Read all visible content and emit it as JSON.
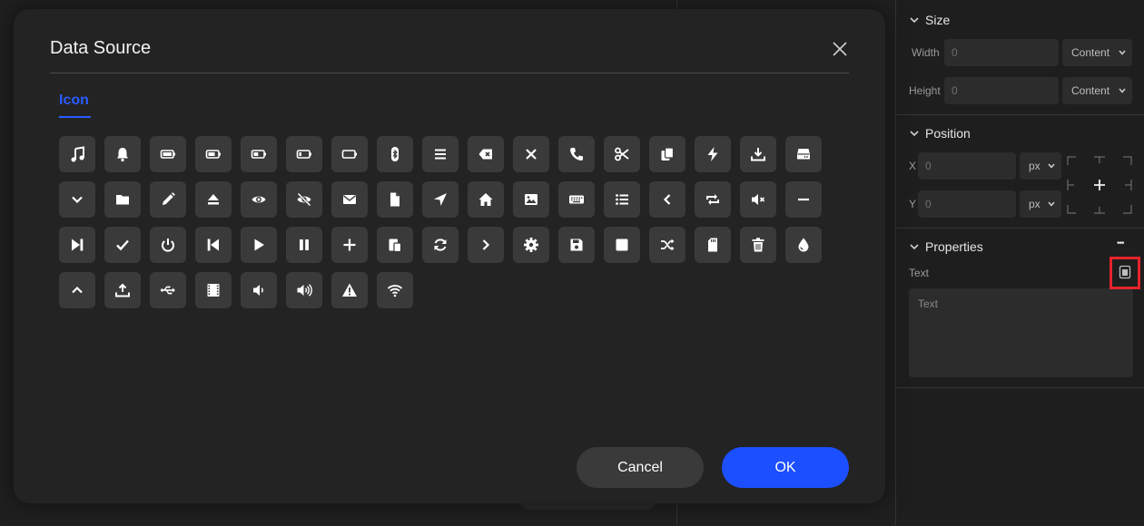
{
  "dialog": {
    "title": "Data Source",
    "tab_label": "Icon",
    "cancel_label": "Cancel",
    "ok_label": "OK",
    "icons": [
      "music",
      "bell",
      "battery-full",
      "battery-three-quarters",
      "battery-half",
      "battery-quarter",
      "battery-empty",
      "bluetooth",
      "menu",
      "backspace",
      "close",
      "phone",
      "cut",
      "copy",
      "bolt",
      "download",
      "drive",
      "chevron-down",
      "folder",
      "edit",
      "eject",
      "eye",
      "eye-slash",
      "envelope",
      "file",
      "location-arrow",
      "home",
      "image",
      "keyboard",
      "list",
      "chevron-left",
      "loop",
      "volume-mute",
      "minus",
      "next",
      "check",
      "power",
      "previous",
      "play",
      "pause",
      "plus",
      "paste",
      "refresh",
      "chevron-right",
      "settings",
      "save",
      "stop",
      "shuffle",
      "sd-card",
      "trash",
      "tint",
      "chevron-up",
      "upload",
      "usb",
      "video",
      "volume-down",
      "volume-up",
      "warning",
      "wifi"
    ]
  },
  "panel": {
    "size": {
      "title": "Size",
      "width_label": "Width",
      "width_value": "0",
      "width_unit": "Content",
      "height_label": "Height",
      "height_value": "0",
      "height_unit": "Content"
    },
    "position": {
      "title": "Position",
      "x_label": "X",
      "x_value": "0",
      "x_unit": "px",
      "y_label": "Y",
      "y_value": "0",
      "y_unit": "px"
    },
    "properties": {
      "title": "Properties",
      "more": "•••",
      "text_label": "Text",
      "text_placeholder": "Text"
    }
  }
}
